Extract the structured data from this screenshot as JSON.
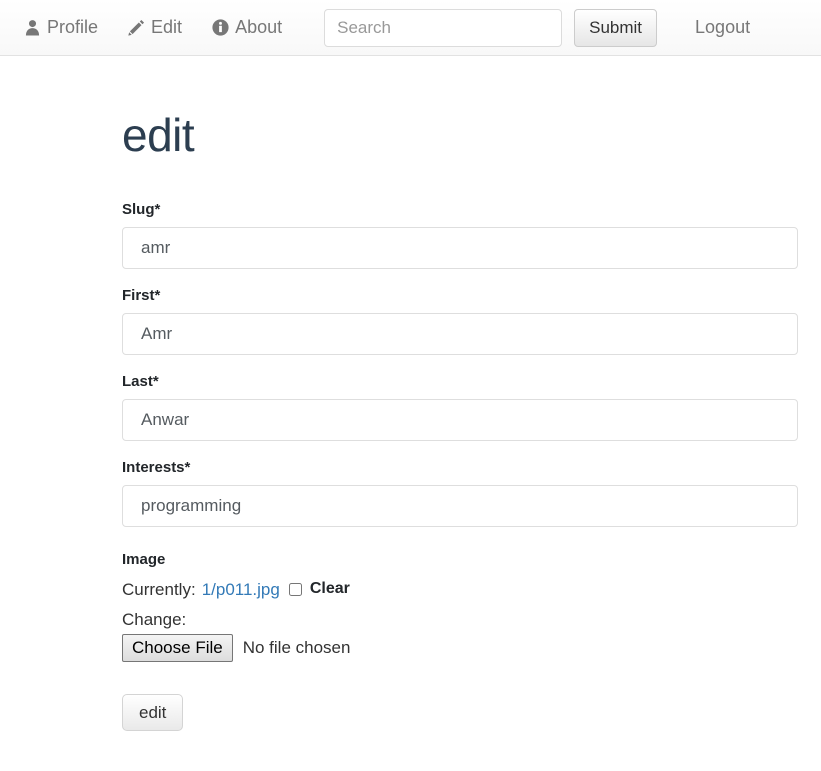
{
  "navbar": {
    "items": [
      {
        "label": "Profile",
        "icon": "user-icon"
      },
      {
        "label": "Edit",
        "icon": "pencil-icon"
      },
      {
        "label": "About",
        "icon": "info-circle-icon"
      }
    ],
    "search": {
      "placeholder": "Search",
      "value": "",
      "submit_label": "Submit"
    },
    "logout_label": "Logout"
  },
  "page": {
    "title": "edit"
  },
  "form": {
    "fields": [
      {
        "label": "Slug*",
        "value": "amr"
      },
      {
        "label": "First*",
        "value": "Amr"
      },
      {
        "label": "Last*",
        "value": "Anwar"
      },
      {
        "label": "Interests*",
        "value": "programming"
      }
    ],
    "image": {
      "label": "Image",
      "currently_label": "Currently:",
      "current_file": "1/p011.jpg",
      "clear_label": "Clear",
      "clear_checked": false,
      "change_label": "Change:",
      "choose_file_label": "Choose File",
      "no_file_text": "No file chosen"
    },
    "submit_label": "edit"
  },
  "colors": {
    "link": "#337ab7",
    "title": "#2c3e50",
    "nav_text": "#777777",
    "border": "#dedede"
  }
}
